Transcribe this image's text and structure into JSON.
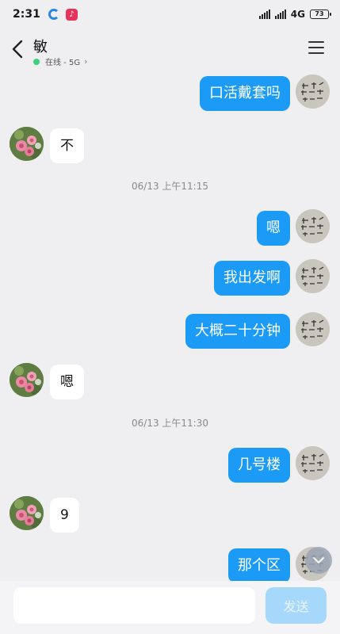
{
  "status_bar": {
    "time": "2:31",
    "network": "4G",
    "battery": "73"
  },
  "header": {
    "contact_name": "敏",
    "presence": "在线 - 5G"
  },
  "icons": {
    "back": "chevron-left-icon",
    "menu": "hamburger-menu-icon",
    "scroll_down": "chevron-down-icon",
    "presence": "online-dot"
  },
  "colors": {
    "outgoing_bubble": "#1b9bf5",
    "incoming_bubble": "#ffffff",
    "background": "#efeff2",
    "online_dot": "#3ed17a",
    "send_disabled": "#a5d8fa"
  },
  "messages": [
    {
      "type": "out",
      "text": "口活戴套吗"
    },
    {
      "type": "in",
      "text": "不"
    },
    {
      "type": "time",
      "text": "06/13 上午11:15"
    },
    {
      "type": "out",
      "text": "嗯"
    },
    {
      "type": "out",
      "text": "我出发啊"
    },
    {
      "type": "out",
      "text": "大概二十分钟"
    },
    {
      "type": "in",
      "text": "嗯"
    },
    {
      "type": "time",
      "text": "06/13 上午11:30"
    },
    {
      "type": "out",
      "text": "几号楼"
    },
    {
      "type": "in",
      "text": "9"
    },
    {
      "type": "out",
      "text": "那个区"
    }
  ],
  "composer": {
    "input_value": "",
    "send_label": "发送"
  }
}
